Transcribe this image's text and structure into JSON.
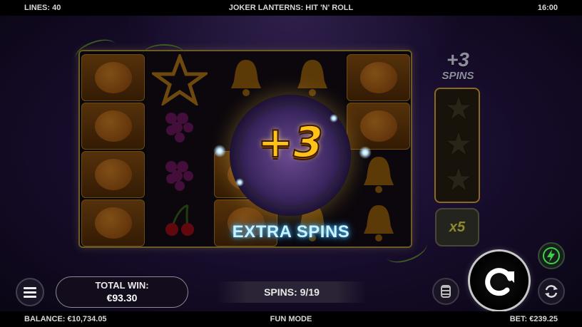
{
  "topbar": {
    "lines": "LINES: 40",
    "title": "JOKER LANTERNS: HIT 'N' ROLL",
    "clock": "16:00"
  },
  "feature": {
    "badge": "+3",
    "banner": "EXTRA SPINS"
  },
  "side_panel": {
    "plus_label": "+3",
    "spins_label": "SPINS",
    "multiplier": "x5",
    "stars_collected": 0,
    "stars_total": 3
  },
  "reels": {
    "columns": [
      [
        "pumpkin",
        "pumpkin",
        "pumpkin",
        "pumpkin"
      ],
      [
        "star",
        "grapes",
        "grapes",
        "cherries"
      ],
      [
        "bell",
        "blank",
        "pumpkin",
        "pumpkin"
      ],
      [
        "bell",
        "blank",
        "bell",
        "bell"
      ],
      [
        "pumpkin",
        "pumpkin",
        "bell",
        "bell"
      ]
    ]
  },
  "controls": {
    "total_win_label": "TOTAL WIN:",
    "total_win_value": "€93.30",
    "spins_counter": "SPINS: 9/19",
    "menu_icon": "menu-icon",
    "spin_icon": "spin-arrow-icon",
    "turbo_icon": "lightning-icon",
    "auto_icon": "autoplay-icon",
    "stake_icon": "coin-stack-icon"
  },
  "bottombar": {
    "balance": "BALANCE: €10,734.05",
    "mode": "FUN MODE",
    "bet": "BET: €239.25"
  },
  "colors": {
    "gold": "#f0c14a",
    "extra_spins_glow": "#48b8ff",
    "turbo_green": "#3ed04a"
  }
}
